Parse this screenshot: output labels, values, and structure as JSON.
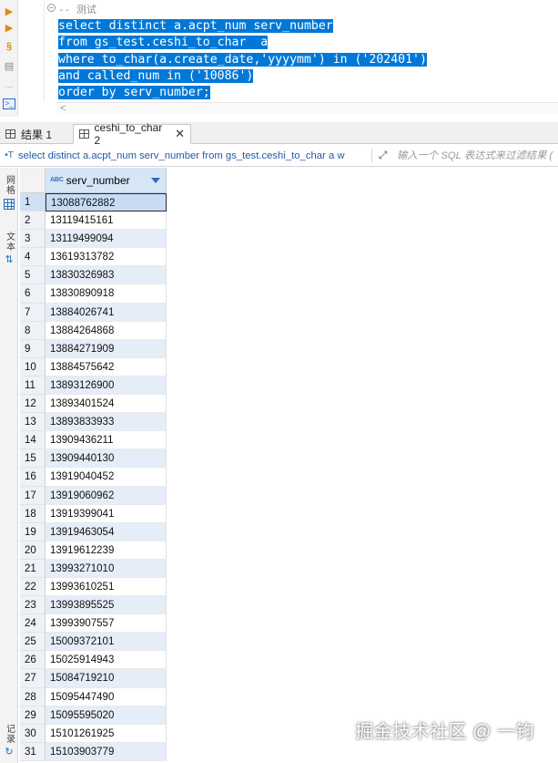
{
  "editor": {
    "comment": "-- 测试",
    "sql_lines": [
      "select distinct a.acpt_num serv_number",
      "from gs_test.ceshi_to_char  a",
      "where to_char(a.create_date,'yyyymm') in ('202401')",
      "and called_num in ('10086')",
      "order by serv_number;"
    ]
  },
  "tabs": [
    {
      "label": "结果 1",
      "icon": "grid-icon",
      "active": false
    },
    {
      "label": "ceshi_to_char 2",
      "icon": "grid-icon",
      "active": true,
      "close": "✕"
    }
  ],
  "filter_bar": {
    "query": "select distinct a.acpt_num serv_number from gs_test.ceshi_to_char a w",
    "placeholder": "输入一个 SQL 表达式来过滤结果 (",
    "expand_icon": "expand-icon"
  },
  "side_panel": {
    "grid_label": "网格",
    "text_label": "文本",
    "record_label": "记录"
  },
  "grid": {
    "column": {
      "type_badge": "ABC",
      "name": "serv_number"
    },
    "selected_row": 1,
    "rows": [
      {
        "n": "1",
        "v": "13088762882"
      },
      {
        "n": "2",
        "v": "13119415161"
      },
      {
        "n": "3",
        "v": "13119499094"
      },
      {
        "n": "4",
        "v": "13619313782"
      },
      {
        "n": "5",
        "v": "13830326983"
      },
      {
        "n": "6",
        "v": "13830890918"
      },
      {
        "n": "7",
        "v": "13884026741"
      },
      {
        "n": "8",
        "v": "13884264868"
      },
      {
        "n": "9",
        "v": "13884271909"
      },
      {
        "n": "10",
        "v": "13884575642"
      },
      {
        "n": "11",
        "v": "13893126900"
      },
      {
        "n": "12",
        "v": "13893401524"
      },
      {
        "n": "13",
        "v": "13893833933"
      },
      {
        "n": "14",
        "v": "13909436211"
      },
      {
        "n": "15",
        "v": "13909440130"
      },
      {
        "n": "16",
        "v": "13919040452"
      },
      {
        "n": "17",
        "v": "13919060962"
      },
      {
        "n": "18",
        "v": "13919399041"
      },
      {
        "n": "19",
        "v": "13919463054"
      },
      {
        "n": "20",
        "v": "13919612239"
      },
      {
        "n": "21",
        "v": "13993271010"
      },
      {
        "n": "22",
        "v": "13993610251"
      },
      {
        "n": "23",
        "v": "13993895525"
      },
      {
        "n": "24",
        "v": "13993907557"
      },
      {
        "n": "25",
        "v": "15009372101"
      },
      {
        "n": "26",
        "v": "15025914943"
      },
      {
        "n": "27",
        "v": "15084719210"
      },
      {
        "n": "28",
        "v": "15095447490"
      },
      {
        "n": "29",
        "v": "15095595020"
      },
      {
        "n": "30",
        "v": "15101261925"
      },
      {
        "n": "31",
        "v": "15103903779"
      }
    ]
  },
  "watermark": "掘金技术社区 @ 一钧",
  "colors": {
    "selection": "#0078d7",
    "header": "#d7e6f6",
    "alt_row": "#e5edf8",
    "accent": "#2a6ebd"
  }
}
